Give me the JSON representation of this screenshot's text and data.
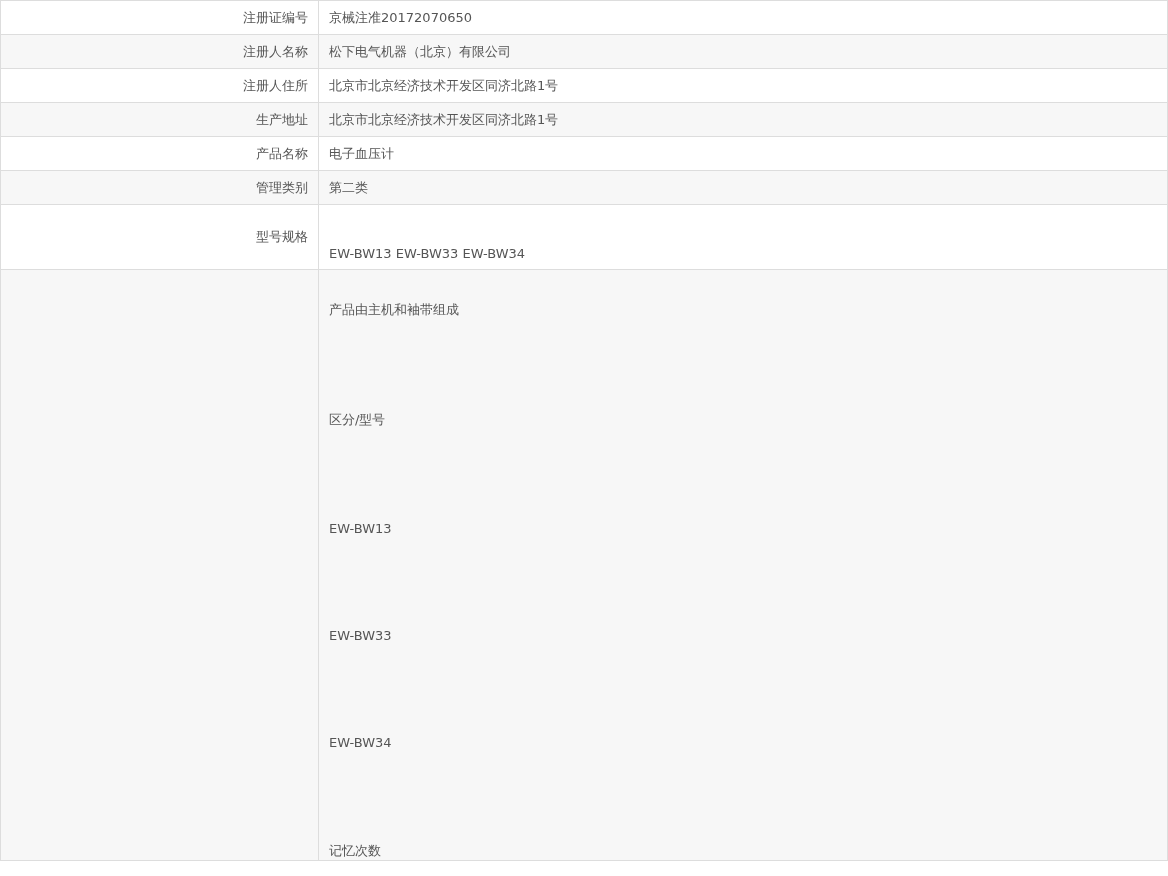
{
  "rows": [
    {
      "label": "注册证编号",
      "value": [
        "京械注准20172070650"
      ]
    },
    {
      "label": "注册人名称",
      "value": [
        "松下电气机器（北京）有限公司"
      ]
    },
    {
      "label": "注册人住所",
      "value": [
        "北京市北京经济技术开发区同济北路1号"
      ]
    },
    {
      "label": "生产地址",
      "value": [
        "北京市北京经济技术开发区同济北路1号"
      ]
    },
    {
      "label": "产品名称",
      "value": [
        "电子血压计"
      ]
    },
    {
      "label": "管理类别",
      "value": [
        "第二类"
      ]
    },
    {
      "label": "型号规格",
      "value": [
        "EW-BW13 EW-BW33 EW-BW34"
      ],
      "kind": "tall"
    },
    {
      "value": [
        "产品由主机和袖带组成",
        "区分/型号",
        "EW-BW13",
        "EW-BW33",
        "EW-BW34",
        "记忆次数"
      ],
      "kind": "long"
    }
  ]
}
